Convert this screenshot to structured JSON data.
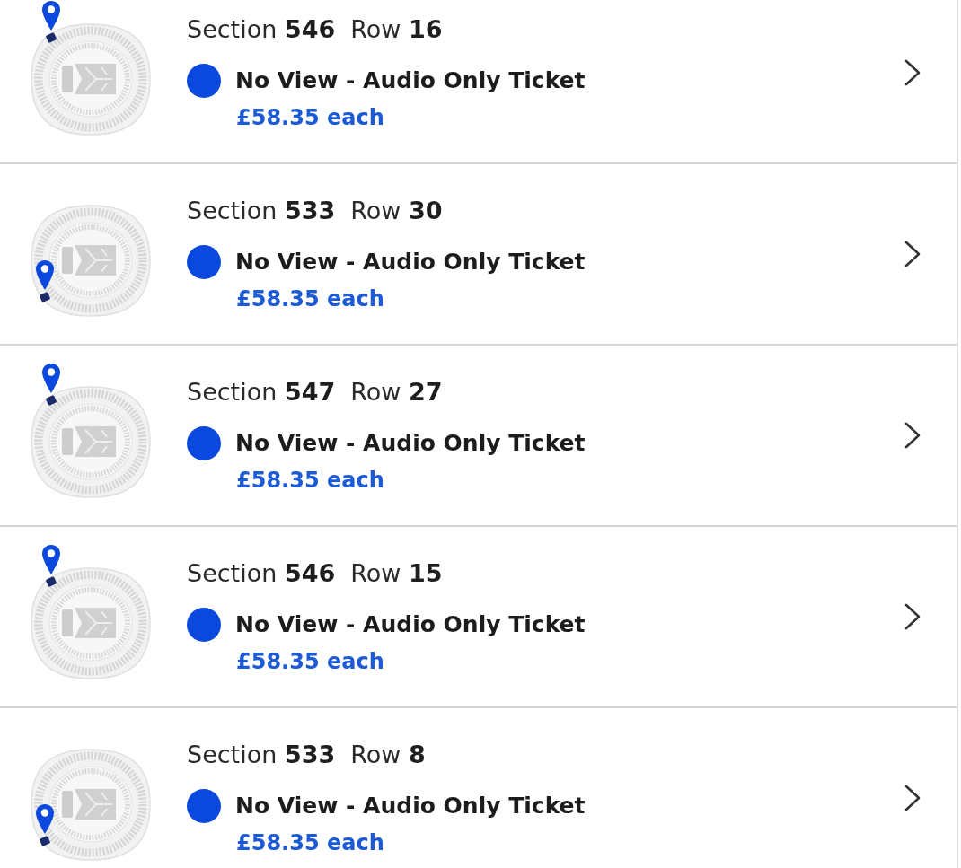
{
  "listings": [
    {
      "section": "Section **546**",
      "row": "Row **16**",
      "pin_at_bottom": false,
      "color": "#0b48de",
      "ticket_type": "No View - Audio Only Ticket",
      "price": "£58.35 each"
    },
    {
      "section": "Section **533**",
      "row": "Row **30**",
      "pin_at_bottom": true,
      "color": "#0b48de",
      "ticket_type": "No View - Audio Only Ticket",
      "price": "£58.35 each"
    },
    {
      "section": "Section **547**",
      "row": "Row **27**",
      "pin_at_bottom": false,
      "color": "#0b48de",
      "ticket_type": "No View - Audio Only Ticket",
      "price": "£58.35 each"
    },
    {
      "section": "Section **546**",
      "row": "Row **15**",
      "pin_at_bottom": false,
      "color": "#0b48de",
      "ticket_type": "No View - Audio Only Ticket",
      "price": "£58.35 each"
    },
    {
      "section": "Section **533**",
      "row": "Row **8**",
      "pin_at_bottom": true,
      "color": "#0b48de",
      "ticket_type": "No View - Audio Only Ticket",
      "price": "£58.35 each"
    }
  ]
}
